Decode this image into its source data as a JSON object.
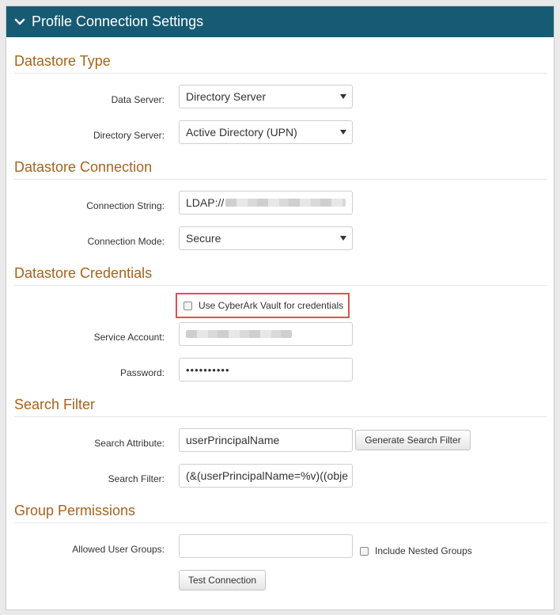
{
  "panel": {
    "title": "Profile Connection Settings"
  },
  "sections": {
    "datastore_type": "Datastore Type",
    "datastore_connection": "Datastore Connection",
    "datastore_credentials": "Datastore Credentials",
    "search_filter": "Search Filter",
    "group_permissions": "Group Permissions"
  },
  "fields": {
    "data_server": {
      "label": "Data Server:",
      "value": "Directory Server"
    },
    "directory_server": {
      "label": "Directory Server:",
      "value": "Active Directory (UPN)"
    },
    "connection_string": {
      "label": "Connection String:",
      "value": "LDAP://"
    },
    "connection_mode": {
      "label": "Connection Mode:",
      "value": "Secure"
    },
    "use_vault": {
      "label": "Use CyberArk Vault for credentials",
      "checked": false
    },
    "service_account": {
      "label": "Service Account:",
      "value": ""
    },
    "password": {
      "label": "Password:",
      "value": "••••••••••"
    },
    "search_attribute": {
      "label": "Search Attribute:",
      "value": "userPrincipalName"
    },
    "search_filter": {
      "label": "Search Filter:",
      "value": "(&(userPrincipalName=%v)((obje"
    },
    "allowed_user_groups": {
      "label": "Allowed User Groups:",
      "value": ""
    },
    "include_nested": {
      "label": "Include Nested Groups",
      "checked": false
    }
  },
  "buttons": {
    "generate_search_filter": "Generate Search Filter",
    "test_connection": "Test Connection"
  },
  "colors": {
    "header_bg": "#175a73",
    "section_title": "#a8621b",
    "highlight_border": "#d9534f"
  }
}
